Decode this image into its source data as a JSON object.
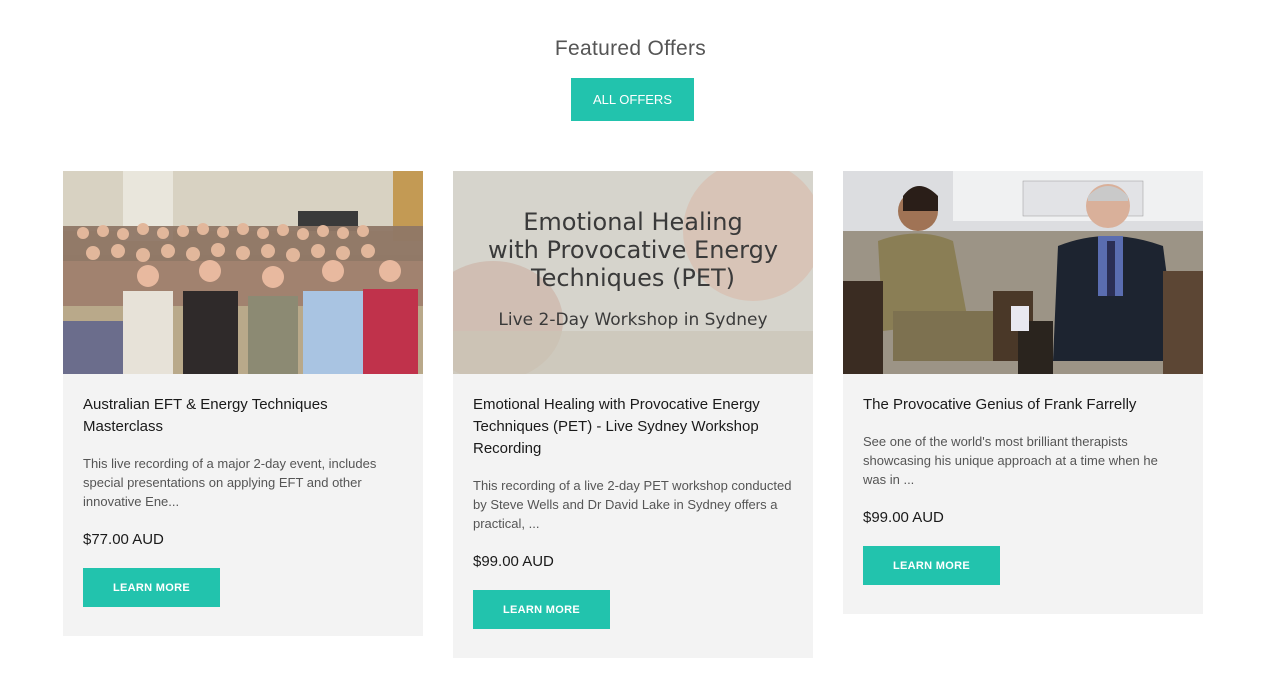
{
  "section": {
    "title": "Featured Offers",
    "all_offers_label": "ALL OFFERS"
  },
  "colors": {
    "accent": "#22c3ad",
    "card_bg": "#f3f3f3"
  },
  "offers": [
    {
      "image_alt": "Audience photo at workshop",
      "title": "Australian EFT & Energy Techniques Masterclass",
      "description": "This live recording of a major 2-day event, includes special presentations on applying EFT and other innovative Ene...",
      "price": "$77.00 AUD",
      "cta": "LEARN MORE"
    },
    {
      "image_alt": "Emotional Healing with Provocative Energy Techniques (PET) banner",
      "image_text": {
        "line1": "Emotional Healing",
        "line2": "with Provocative Energy",
        "line3": "Techniques (PET)",
        "line4": "Live 2-Day Workshop in Sydney"
      },
      "title": "Emotional Healing with Provocative Energy Techniques (PET) - Live Sydney Workshop Recording",
      "description": "This recording of a live 2-day PET workshop conducted by Steve Wells and Dr David Lake in Sydney offers a practical, ...",
      "price": "$99.00 AUD",
      "cta": "LEARN MORE"
    },
    {
      "image_alt": "Two people seated in conversation",
      "title": "The Provocative Genius of Frank Farrelly",
      "description": "See one of the world's most brilliant therapists showcasing his unique approach at a time when he was in ...",
      "price": "$99.00 AUD",
      "cta": "LEARN MORE"
    }
  ]
}
